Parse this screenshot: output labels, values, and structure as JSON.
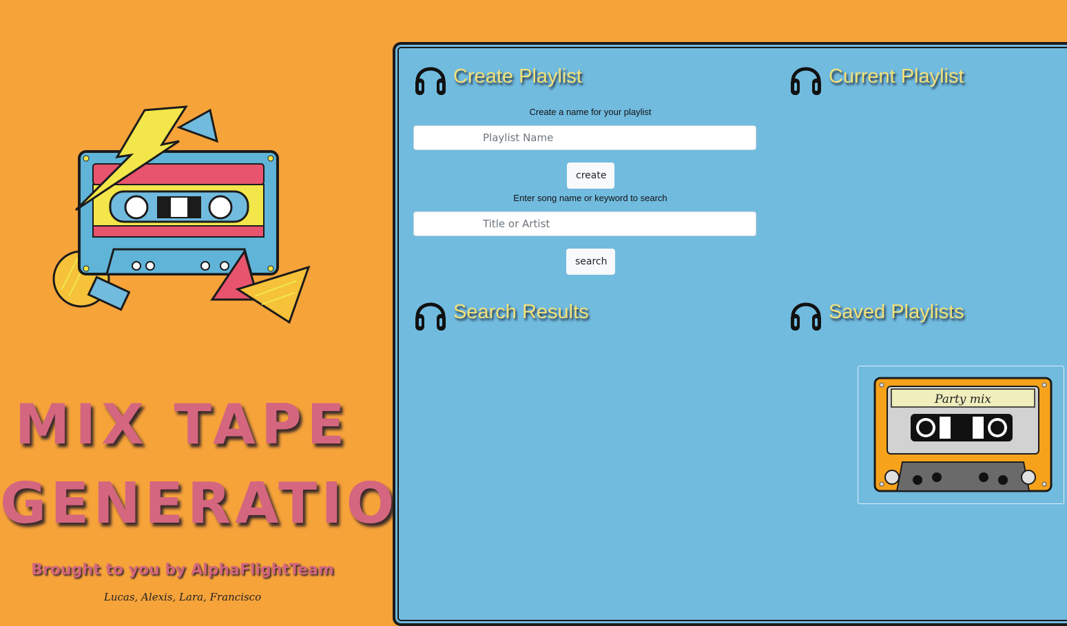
{
  "hero": {
    "title_line1": "MIX TAPE",
    "title_line2": "GENERATION",
    "credit": "Brought to you by AlphaFlightTeam",
    "names": "Lucas, Alexis, Lara, Francisco",
    "art_icon": "cassette-tape-illustration"
  },
  "create_section": {
    "heading": "Create Playlist",
    "icon": "headphones-icon",
    "name_label": "Create a name for your playlist",
    "name_placeholder": "Playlist Name",
    "create_button": "create",
    "search_label": "Enter song name or keyword to search",
    "search_placeholder": "Title or Artist",
    "search_button": "search"
  },
  "current_section": {
    "heading": "Current Playlist",
    "icon": "headphones-icon"
  },
  "results_section": {
    "heading": "Search Results",
    "icon": "headphones-icon"
  },
  "saved_section": {
    "heading": "Saved Playlists",
    "icon": "headphones-icon",
    "playlists": [
      {
        "label": "Party mix",
        "icon": "cassette-icon"
      }
    ]
  },
  "colors": {
    "page_bg": "#f6a33a",
    "panel_bg": "#71bbdf",
    "heading_text": "#f3e27a",
    "hero_text": "#d4667f"
  }
}
